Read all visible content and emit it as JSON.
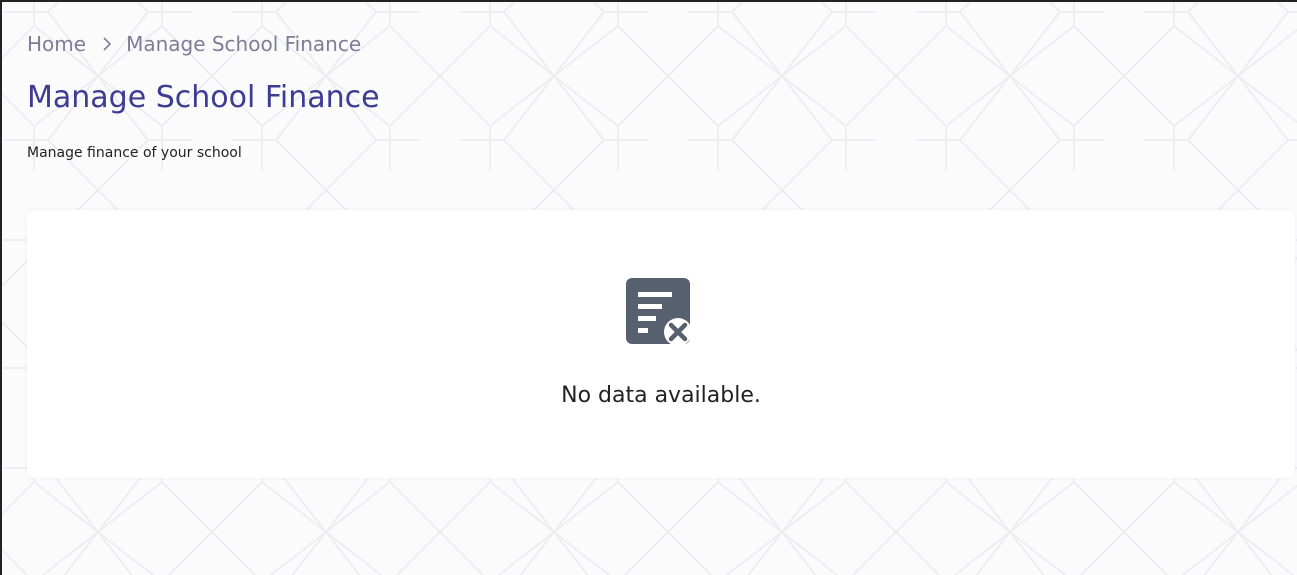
{
  "breadcrumb": {
    "home": "Home",
    "current": "Manage School Finance"
  },
  "page": {
    "title": "Manage School Finance",
    "subtitle": "Manage finance of your school"
  },
  "empty_state": {
    "icon": "no-data-icon",
    "message": "No data available."
  },
  "colors": {
    "title": "#3d3c92",
    "breadcrumb": "#7b7e95",
    "icon": "#57606f",
    "background": "#fbfbfc",
    "card": "#ffffff"
  }
}
